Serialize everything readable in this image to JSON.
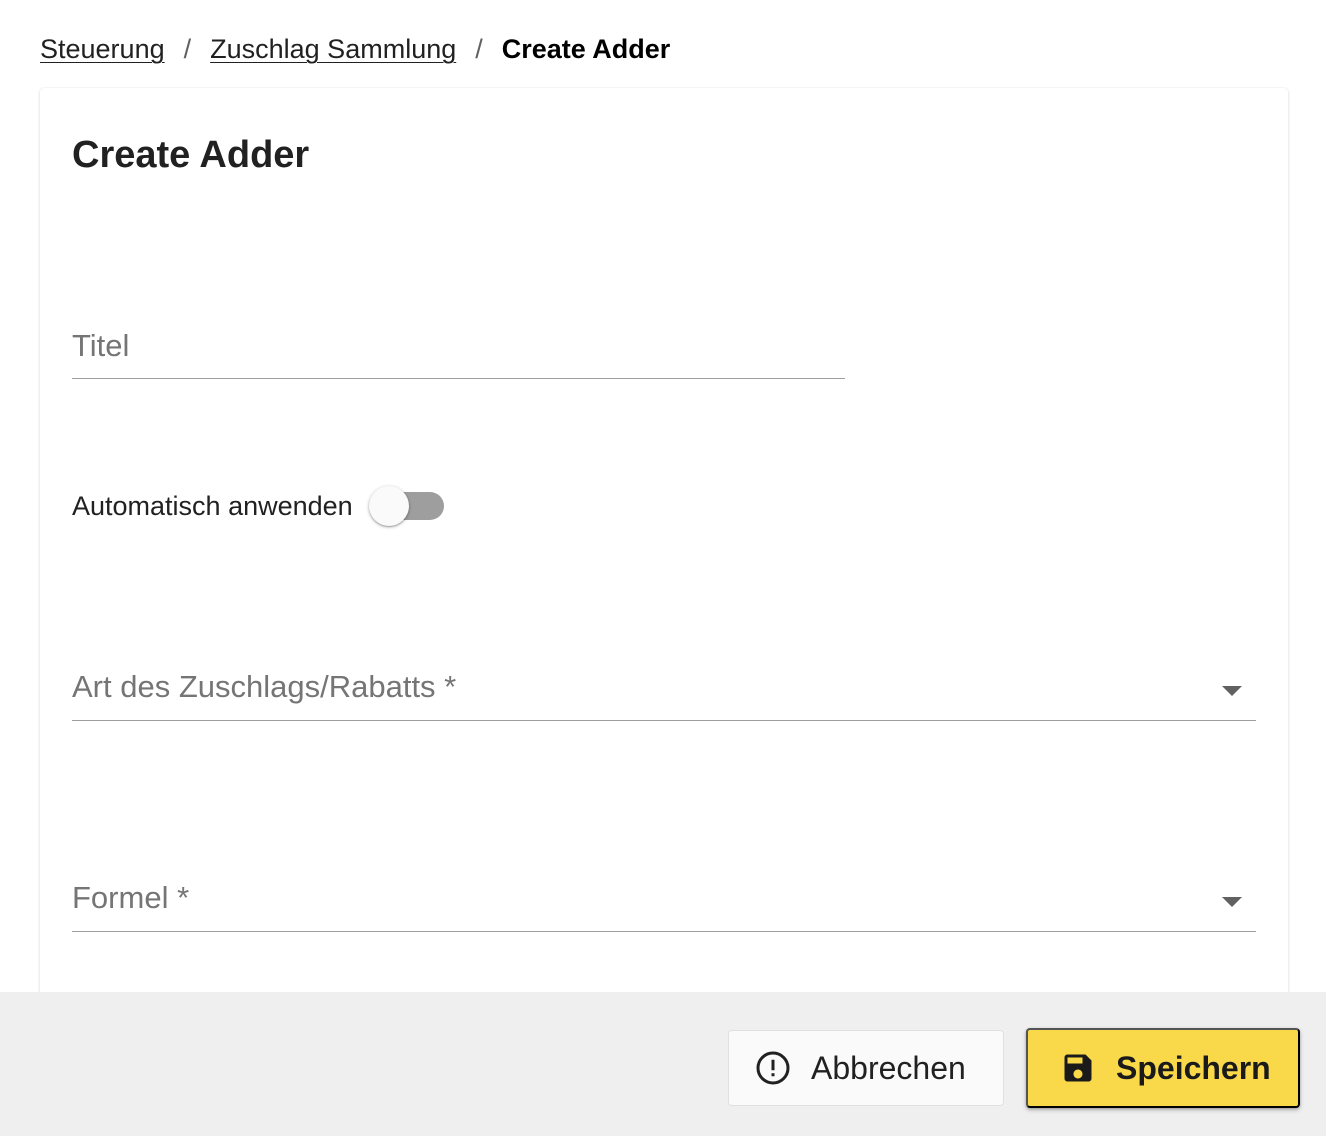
{
  "breadcrumb": {
    "items": [
      {
        "label": "Steuerung"
      },
      {
        "label": "Zuschlag Sammlung"
      }
    ],
    "separator": "/",
    "current": "Create Adder"
  },
  "card": {
    "title": "Create Adder"
  },
  "form": {
    "title_field": {
      "label": "Titel",
      "value": ""
    },
    "auto_apply": {
      "label": "Automatisch anwenden",
      "checked": false
    },
    "adder_type": {
      "label": "Art des Zuschlags/Rabatts *",
      "value": ""
    },
    "formula": {
      "label": "Formel *",
      "value": ""
    }
  },
  "footer": {
    "cancel_label": "Abbrechen",
    "save_label": "Speichern"
  },
  "colors": {
    "accent": "#f9d94a",
    "footer_bg": "#efefef",
    "switch_track_off": "#9e9e9e"
  },
  "icons": {
    "cancel": "alert-circle-outline-icon",
    "save": "floppy-disk-icon",
    "dropdown": "caret-down-icon"
  }
}
